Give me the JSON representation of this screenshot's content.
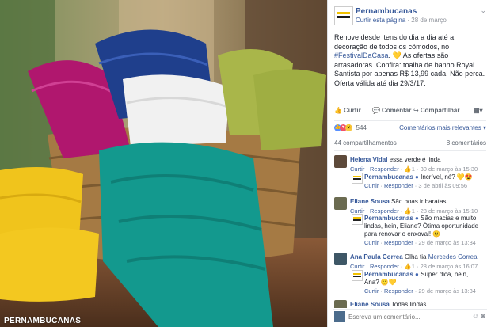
{
  "photo": {
    "watermark": "PERNAMBUCANAS",
    "alt_description_icon": "towels-in-basket-image"
  },
  "post": {
    "page_name": "Pernambucanas",
    "curtir_page": "Curtir esta página",
    "sep": "·",
    "date": "28 de março",
    "text_part1": "Renove desde itens do dia a dia até a decoração de todos os cômodos, no ",
    "hashtag": "#FestivalDaCasa",
    "text_part2": ". ",
    "heart": "💛",
    "text_part3": " As ofertas são arrasadoras. Confira: toalha de banho Royal Santista por apenas R$ 13,99 cada. Não perca. Oferta válida até dia 29/3/17."
  },
  "actions": {
    "like": "Curtir",
    "comment": "Comentar",
    "share": "Compartilhar"
  },
  "reactions": {
    "count": "544",
    "relevant": "Comentários mais relevantes ▾"
  },
  "stats": {
    "shares": "44 compartilhamentos",
    "comments": "8 comentários"
  },
  "comments": [
    {
      "name": "Helena Vidal",
      "text": "essa verde é linda",
      "meta_like": "Curtir",
      "meta_reply": "Responder",
      "meta_likes": "1",
      "meta_date": "30 de março às 15:30"
    },
    {
      "name": "Pernambucanas",
      "text": "Incrível, né? 💛😍",
      "meta_like": "Curtir",
      "meta_reply": "Responder",
      "meta_date": "3 de abril às 09:56"
    },
    {
      "name": "Eliane Sousa",
      "text": "São boas ir baratas",
      "meta_like": "Curtir",
      "meta_reply": "Responder",
      "meta_likes": "1",
      "meta_date": "28 de março às 15:10"
    },
    {
      "name": "Pernambucanas",
      "text": "São macias e muito lindas, hein, Eliane? Ótima oportunidade para renovar o enxoval! 🙂",
      "meta_like": "Curtir",
      "meta_reply": "Responder",
      "meta_date": "29 de março às 13:34"
    },
    {
      "name": "Ana Paula Correa",
      "text": "Olha tia",
      "mention": "Mercedes Correal",
      "meta_like": "Curtir",
      "meta_reply": "Responder",
      "meta_likes": "1",
      "meta_date": "28 de março às 16:07"
    },
    {
      "name": "Pernambucanas",
      "text": "Super dica, hein, Ana? 🙂💛",
      "meta_like": "Curtir",
      "meta_reply": "Responder",
      "meta_date": "29 de março às 13:34"
    },
    {
      "name": "Eliane Sousa",
      "text": "Todas lindas"
    }
  ],
  "write": {
    "placeholder": "Escreva um comentário..."
  },
  "colors": {
    "link": "#365899",
    "brand_yellow": "#f2c200",
    "like_blue": "#5890ff"
  }
}
